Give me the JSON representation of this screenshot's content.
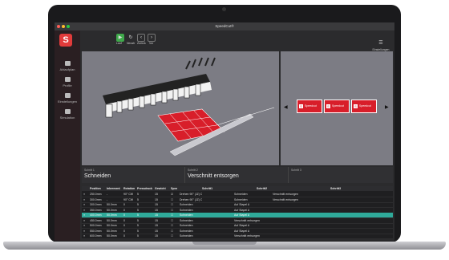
{
  "window": {
    "title": "SpeedCut®"
  },
  "toolbar": {
    "buttons": [
      {
        "icon": "play-icon",
        "label": "Lauf"
      },
      {
        "icon": "reset-icon",
        "label": "Neustr"
      },
      {
        "icon": "back-icon",
        "label": "Zurück"
      },
      {
        "icon": "forward-icon",
        "label": "Vor"
      }
    ],
    "settings_label": "Einstellungen"
  },
  "sidebar": {
    "logo": "S",
    "items": [
      {
        "label": "Ablaufplan"
      },
      {
        "label": "Profile"
      },
      {
        "label": "Einstellungen"
      },
      {
        "label": "Simulation"
      }
    ]
  },
  "labels_view": {
    "card_text": "Speedcut",
    "card_icon": "S",
    "nav_left": "◀",
    "nav_right": "▶"
  },
  "steps": [
    {
      "label": "Schritt 1",
      "value": "Schneiden"
    },
    {
      "label": "Schritt 2",
      "value": "Verschnitt entsorgen"
    },
    {
      "label": "Schritt 3",
      "value": ""
    }
  ],
  "table": {
    "columns": [
      "Position",
      "Inkrement",
      "Rotation",
      "Pressdruck",
      "Gewicht",
      "Spez",
      "Schritt1",
      "Schritt2",
      "Schritt3"
    ],
    "rows": [
      {
        "pos": "250.0mm",
        "ink": "-",
        "rot": "90° CW",
        "p": "5",
        "g": "15",
        "s1": "Drehen 90° (JZ) C",
        "s2": "Schneiden",
        "s3": "Verschnitt entsorgen"
      },
      {
        "pos": "300.0mm",
        "ink": "-",
        "rot": "90° CW",
        "p": "5",
        "g": "15",
        "s1": "Drehen 90° (JZ) C",
        "s2": "Schneiden",
        "s3": "Verschnitt entsorgen"
      },
      {
        "pos": "300.0mm",
        "ink": "50.0mm",
        "rot": "0",
        "p": "5",
        "g": "15",
        "s1": "Schneiden",
        "s2": "Auf Stapel A",
        "s3": ""
      },
      {
        "pos": "350.0mm",
        "ink": "50.0mm",
        "rot": "0",
        "p": "5",
        "g": "15",
        "s1": "Schneiden",
        "s2": "Auf Stapel A",
        "s3": ""
      },
      {
        "pos": "400.0mm",
        "ink": "50.0mm",
        "rot": "0",
        "p": "5",
        "g": "15",
        "s1": "Schneiden",
        "s2": "Auf Stapel A",
        "s3": ""
      },
      {
        "pos": "450.0mm",
        "ink": "50.0mm",
        "rot": "0",
        "p": "5",
        "g": "15",
        "s1": "Schneiden",
        "s2": "Verschnitt entsorgen",
        "s3": ""
      },
      {
        "pos": "500.0mm",
        "ink": "50.0mm",
        "rot": "0",
        "p": "5",
        "g": "15",
        "s1": "Schneiden",
        "s2": "Auf Stapel A",
        "s3": ""
      },
      {
        "pos": "550.0mm",
        "ink": "50.0mm",
        "rot": "0",
        "p": "5",
        "g": "15",
        "s1": "Schneiden",
        "s2": "Auf Stapel A",
        "s3": ""
      },
      {
        "pos": "600.0mm",
        "ink": "50.0mm",
        "rot": "0",
        "p": "5",
        "g": "15",
        "s1": "Schneiden",
        "s2": "Verschnitt entsorgen",
        "s3": ""
      }
    ]
  },
  "colors": {
    "accent": "#e23b3b",
    "selected_row": "#2faa9a",
    "label_red": "#d81e2a"
  }
}
